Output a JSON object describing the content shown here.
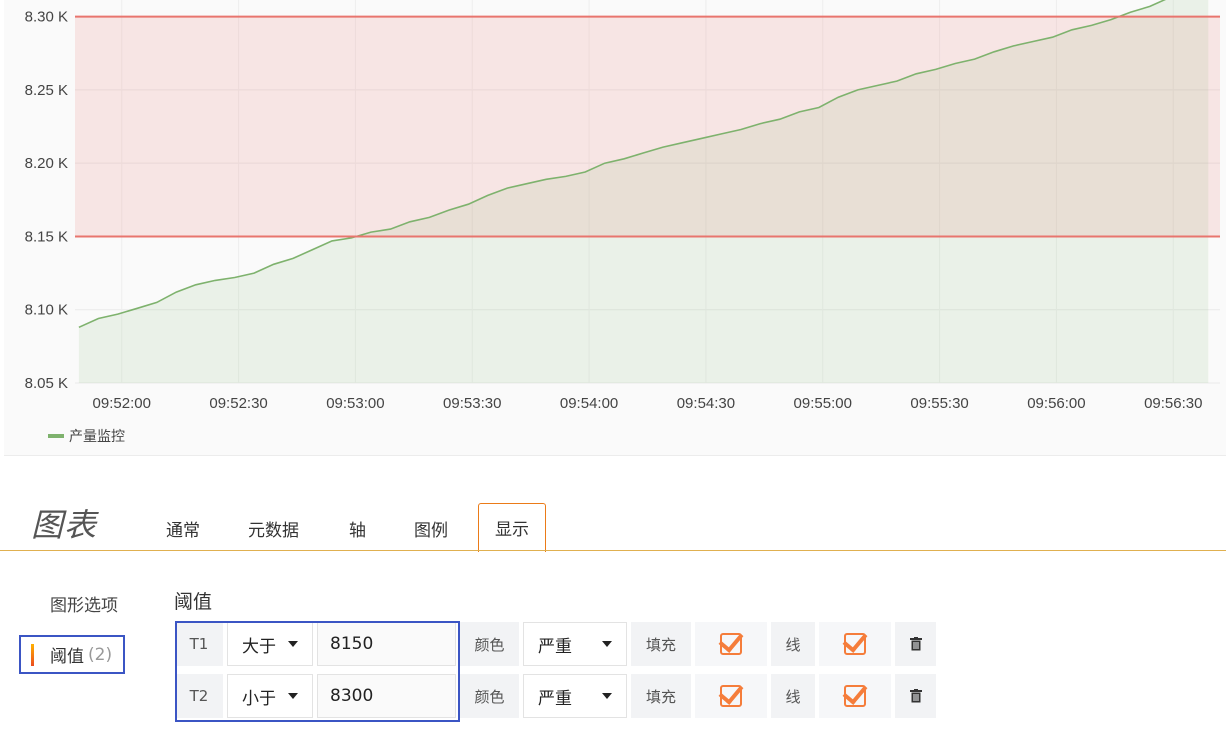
{
  "chart_data": {
    "type": "area",
    "y_ticks": [
      "8.05 K",
      "8.10 K",
      "8.15 K",
      "8.20 K",
      "8.25 K",
      "8.30 K"
    ],
    "x_ticks": [
      "09:52:00",
      "09:52:30",
      "09:53:00",
      "09:53:30",
      "09:54:00",
      "09:54:30",
      "09:55:00",
      "09:55:30",
      "09:56:00",
      "09:56:30"
    ],
    "ylim": [
      8050,
      8325
    ],
    "xlim": [
      "09:51:48",
      "09:56:42"
    ],
    "series": [
      {
        "name": "产量监控",
        "color": "#7eb26d",
        "x": [
          "09:51:49",
          "09:51:54",
          "09:51:59",
          "09:52:04",
          "09:52:09",
          "09:52:14",
          "09:52:19",
          "09:52:24",
          "09:52:29",
          "09:52:34",
          "09:52:39",
          "09:52:44",
          "09:52:49",
          "09:52:54",
          "09:52:59",
          "09:53:04",
          "09:53:09",
          "09:53:14",
          "09:53:19",
          "09:53:24",
          "09:53:29",
          "09:53:34",
          "09:53:39",
          "09:53:44",
          "09:53:49",
          "09:53:54",
          "09:53:59",
          "09:54:04",
          "09:54:09",
          "09:54:14",
          "09:54:19",
          "09:54:24",
          "09:54:29",
          "09:54:34",
          "09:54:39",
          "09:54:44",
          "09:54:49",
          "09:54:54",
          "09:54:59",
          "09:55:04",
          "09:55:09",
          "09:55:14",
          "09:55:19",
          "09:55:24",
          "09:55:29",
          "09:55:34",
          "09:55:39",
          "09:55:44",
          "09:55:49",
          "09:55:54",
          "09:55:59",
          "09:56:04",
          "09:56:09",
          "09:56:14",
          "09:56:19",
          "09:56:24",
          "09:56:29",
          "09:56:34",
          "09:56:39"
        ],
        "values": [
          8088,
          8094,
          8097,
          8101,
          8105,
          8112,
          8117,
          8120,
          8122,
          8125,
          8131,
          8135,
          8141,
          8147,
          8149,
          8153,
          8155,
          8160,
          8163,
          8168,
          8172,
          8178,
          8183,
          8186,
          8189,
          8191,
          8194,
          8200,
          8203,
          8207,
          8211,
          8214,
          8217,
          8220,
          8223,
          8227,
          8230,
          8235,
          8238,
          8245,
          8250,
          8253,
          8256,
          8261,
          8264,
          8268,
          8271,
          8276,
          8280,
          8283,
          8286,
          8291,
          8294,
          8298,
          8303,
          8307,
          8313,
          8317,
          8322
        ]
      }
    ],
    "thresholds": [
      {
        "op": "gt",
        "value": 8150,
        "color": "#e8756e"
      },
      {
        "op": "lt",
        "value": 8300,
        "color": "#e8756e"
      }
    ],
    "legend_position": "bottom-left",
    "grid": true
  },
  "legend": {
    "label": "产量监控"
  },
  "editor": {
    "title": "图表",
    "tabs": [
      "通常",
      "元数据",
      "轴",
      "图例",
      "显示"
    ],
    "active_tab": "显示"
  },
  "sidebar": {
    "item1": "图形选项",
    "item2": "阈值",
    "item2_count": "(2)"
  },
  "thresholds": {
    "title": "阈值",
    "rows": [
      {
        "name": "T1",
        "op": "大于",
        "value": "8150",
        "color_label": "颜色",
        "severity": "严重",
        "fill_label": "填充",
        "line_label": "线"
      },
      {
        "name": "T2",
        "op": "小于",
        "value": "8300",
        "color_label": "颜色",
        "severity": "严重",
        "fill_label": "填充",
        "line_label": "线"
      }
    ]
  }
}
